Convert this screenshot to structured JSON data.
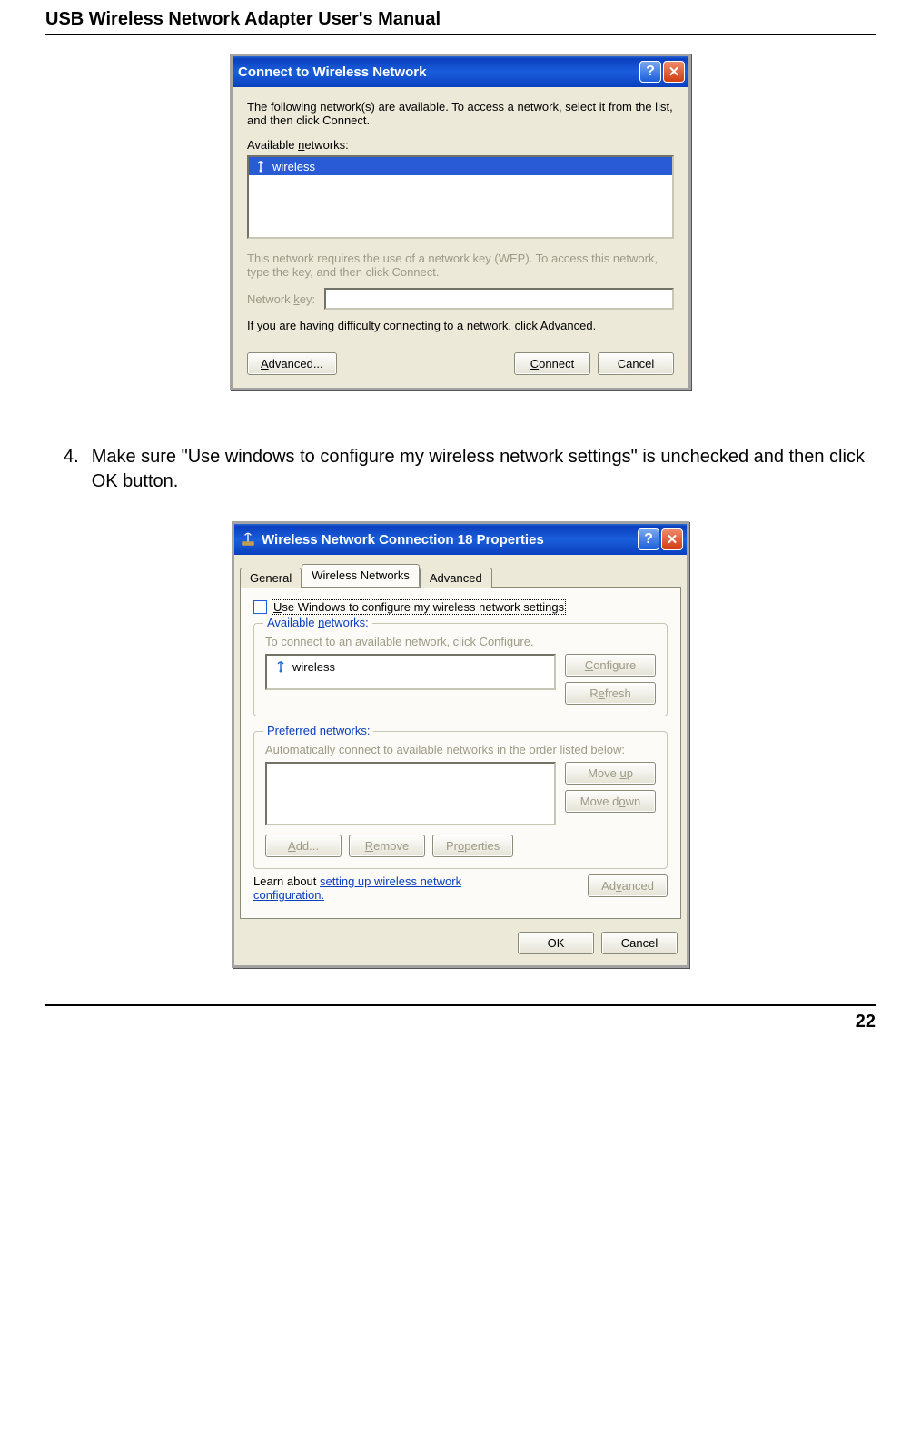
{
  "doc": {
    "header": "USB Wireless Network Adapter User's Manual",
    "step_number": "4.",
    "step_text": "Make sure \"Use windows to configure my wireless network settings\" is unchecked and then click OK button.",
    "page_number": "22"
  },
  "dialog1": {
    "title": "Connect to Wireless Network",
    "intro": "The following network(s) are available. To access a network, select it from the list, and then click Connect.",
    "available_label": "Available networks:",
    "networks": [
      "wireless"
    ],
    "wep_note": "This network requires the use of a network key (WEP). To access this network, type the key, and then click Connect.",
    "key_label": "Network key:",
    "advanced_hint": "If you are having difficulty connecting to a network, click Advanced.",
    "buttons": {
      "advanced": "Advanced...",
      "connect": "Connect",
      "cancel": "Cancel"
    }
  },
  "dialog2": {
    "title": "Wireless Network Connection 18 Properties",
    "tabs": {
      "general": "General",
      "wireless": "Wireless Networks",
      "advanced": "Advanced"
    },
    "checkbox_label": "Use Windows to configure my wireless network settings",
    "available": {
      "legend_pre": "Available ",
      "legend_u": "n",
      "legend_post": "etworks:",
      "hint": "To connect to an available network, click Configure.",
      "items": [
        "wireless"
      ],
      "configure": "Configure",
      "refresh": "Refresh"
    },
    "preferred": {
      "legend_u": "P",
      "legend_post": "referred networks:",
      "hint": "Automatically connect to available networks in the order listed below:",
      "move_up": "Move up",
      "move_down": "Move down",
      "add": "Add...",
      "remove": "Remove",
      "properties": "Properties"
    },
    "learn_pre": "Learn about ",
    "learn_link": "setting up wireless network configuration.",
    "advanced_btn": "Advanced",
    "ok": "OK",
    "cancel": "Cancel"
  }
}
